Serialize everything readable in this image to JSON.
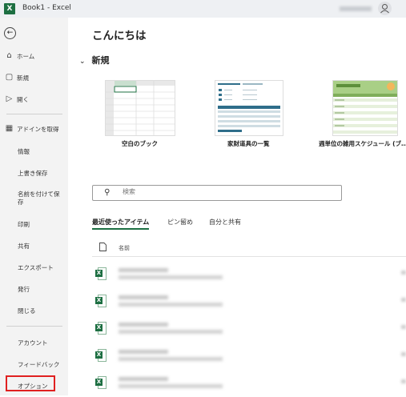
{
  "titlebar": {
    "logo": "X",
    "title": "Book1  -  Excel"
  },
  "sidebar": {
    "back_icon": "←",
    "items": [
      {
        "icon": "⌂",
        "label": "ホーム"
      },
      {
        "icon": "▢",
        "label": "新規"
      },
      {
        "icon": "▷",
        "label": "開く"
      },
      {
        "icon": "▦",
        "label": "アドインを取得"
      },
      {
        "label": "情報"
      },
      {
        "label": "上書き保存"
      },
      {
        "label": "名前を付けて保存"
      },
      {
        "label": "印刷"
      },
      {
        "label": "共有"
      },
      {
        "label": "エクスポート"
      },
      {
        "label": "発行"
      },
      {
        "label": "閉じる"
      },
      {
        "label": "アカウント"
      },
      {
        "label": "フィードバック"
      },
      {
        "label": "オプション"
      }
    ],
    "highlight_color": "#e02020"
  },
  "main": {
    "greeting": "こんにちは",
    "new_section": {
      "chevron": "⌄",
      "title": "新規"
    },
    "templates": [
      {
        "label": "空白のブック"
      },
      {
        "label": "家財道具の一覧"
      },
      {
        "label": "週単位の雑用スケジュール (ブ…"
      }
    ],
    "search": {
      "icon": "⚲",
      "placeholder": "検索"
    },
    "tabs": [
      "最近使ったアイテム",
      "ピン留め",
      "自分と共有"
    ],
    "list_header": {
      "name": "名前"
    },
    "accent_color": "#1d6f42"
  }
}
